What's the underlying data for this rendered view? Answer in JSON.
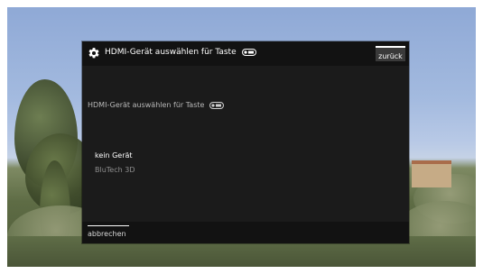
{
  "dialog": {
    "title": "HDMI-Gerät auswählen für Taste",
    "back_label": "zurück",
    "subtitle": "HDMI-Gerät auswählen für Taste",
    "options": [
      {
        "label": "kein Gerät",
        "selected": true
      },
      {
        "label": "BluTech 3D",
        "selected": false
      }
    ],
    "cancel_label": "abbrechen"
  },
  "icons": {
    "settings": "gear-icon",
    "remote_key": "remote-key-icon"
  },
  "colors": {
    "dialog_background": "#1b1b1b",
    "header_background": "#121212",
    "selected_text": "#ffffff",
    "unselected_text": "#8e8e8e"
  }
}
